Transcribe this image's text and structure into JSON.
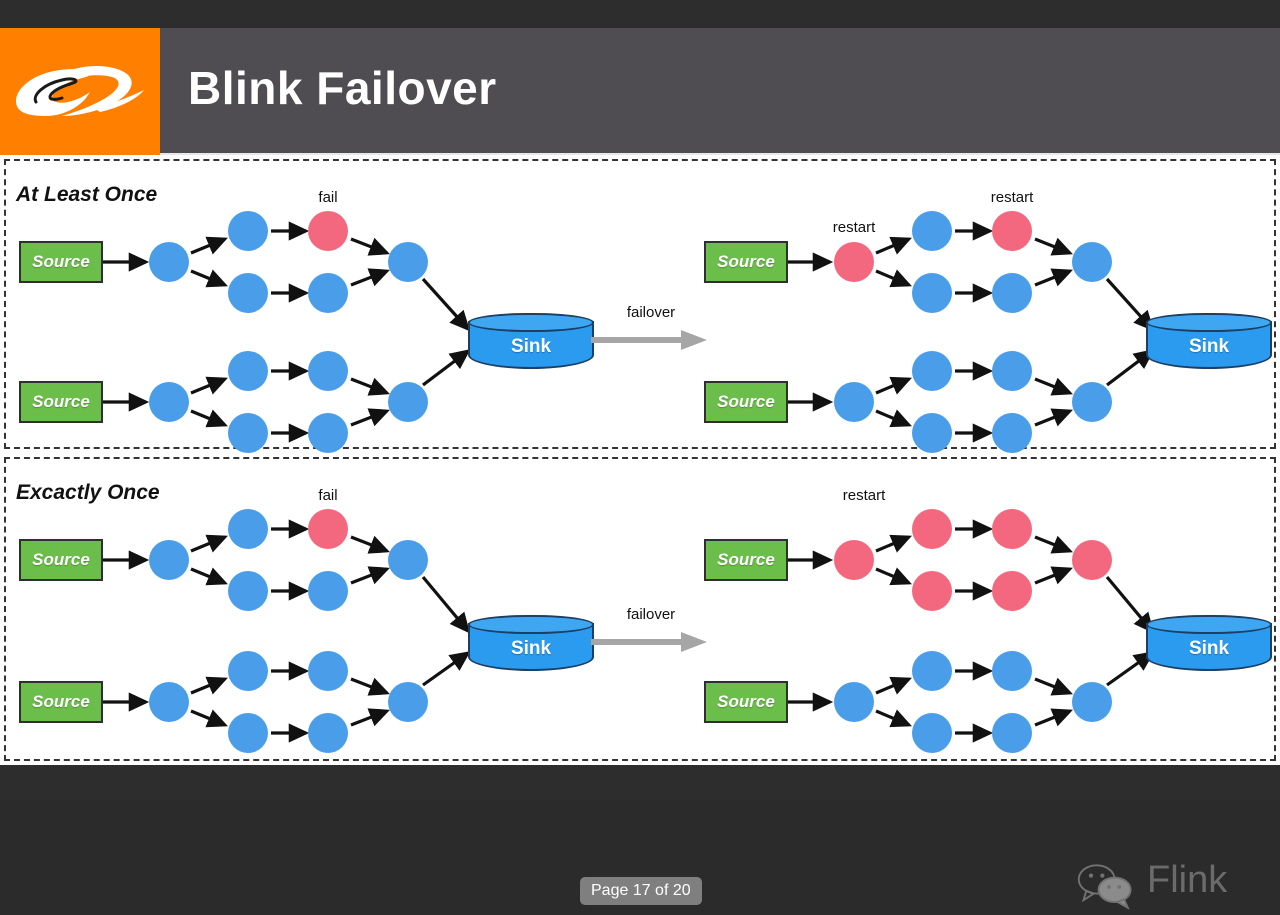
{
  "header": {
    "title": "Blink Failover",
    "logo_icon": "alibaba-logo-icon",
    "logo_bg": "#ff8000",
    "bar_bg": "#4f4c52"
  },
  "colors": {
    "node_blue": "#4a9de8",
    "node_red": "#f4687f",
    "source_green": "#6cbe4a",
    "sink_blue": "#2b9bf0",
    "arrow_gray": "#a6a6a6",
    "dark_chrome": "#2d2d2d"
  },
  "panels": [
    {
      "id": "at-least-once",
      "title": "At Least Once",
      "before": {
        "sources": [
          "Source",
          "Source"
        ],
        "sink": "Sink",
        "labels": [
          {
            "text": "fail",
            "node": "top-stage3-upper"
          }
        ],
        "failed_nodes": [
          "top-stage3-upper"
        ]
      },
      "transition": {
        "label": "failover",
        "icon": "right-arrow-icon"
      },
      "after": {
        "sources": [
          "Source",
          "Source"
        ],
        "sink": "Sink",
        "labels": [
          {
            "text": "restart",
            "node": "top-fanout"
          },
          {
            "text": "restart",
            "node": "top-stage3-upper"
          }
        ],
        "restarted_nodes": [
          "top-fanout",
          "top-stage3-upper"
        ]
      }
    },
    {
      "id": "exactly-once",
      "title": "Excactly Once",
      "before": {
        "sources": [
          "Source",
          "Source"
        ],
        "sink": "Sink",
        "labels": [
          {
            "text": "fail",
            "node": "top-stage3-upper"
          }
        ],
        "failed_nodes": [
          "top-stage3-upper"
        ]
      },
      "transition": {
        "label": "failover",
        "icon": "right-arrow-icon"
      },
      "after": {
        "sources": [
          "Source",
          "Source"
        ],
        "sink": "Sink",
        "labels": [
          {
            "text": "restart",
            "node": "top-fanout"
          }
        ],
        "restarted_nodes": [
          "top-fanout",
          "top-stage2-upper",
          "top-stage2-lower",
          "top-stage3-upper",
          "top-stage3-lower",
          "top-merge"
        ]
      }
    }
  ],
  "page_badge": "Page 17 of 20",
  "watermark": {
    "text": "Flink",
    "icon": "wechat-bubbles-icon"
  }
}
